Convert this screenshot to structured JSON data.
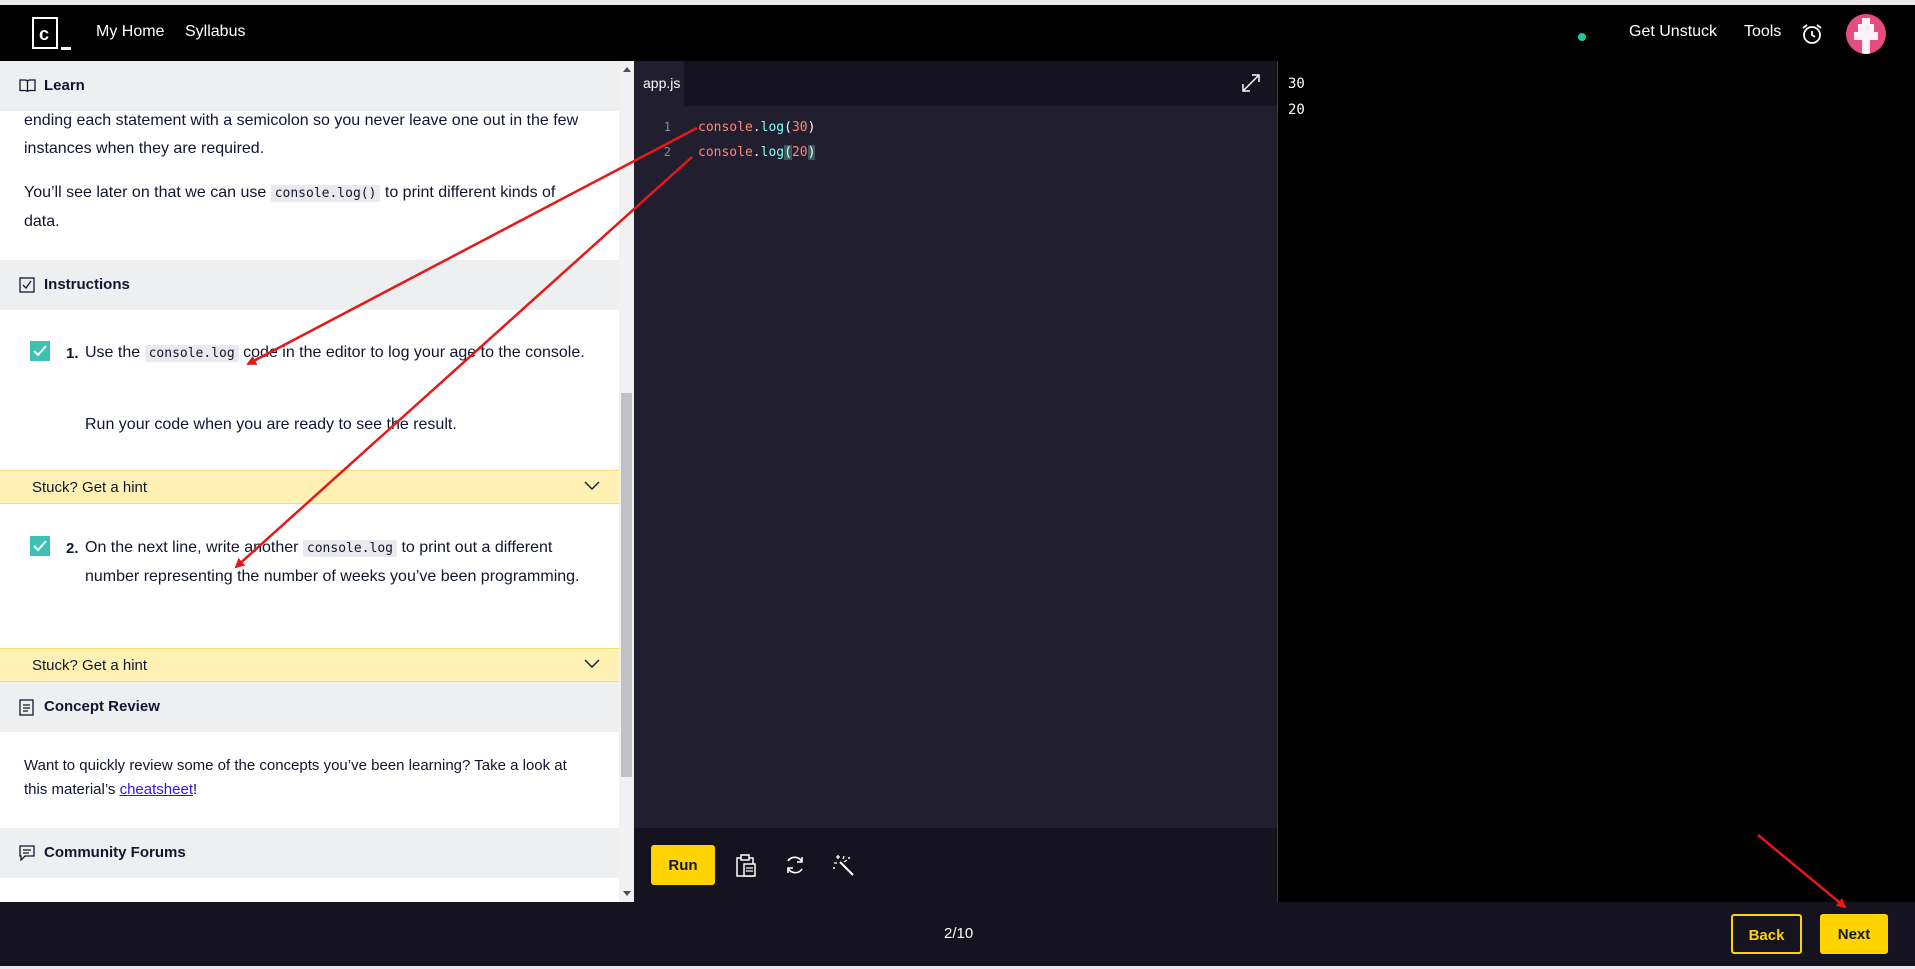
{
  "nav": {
    "logo_letter": "c",
    "my_home": "My Home",
    "syllabus": "Syllabus",
    "get_unstuck": "Get Unstuck",
    "tools": "Tools",
    "status_color": "#19c9a3",
    "avatar_color": "#e64c7d"
  },
  "learn": {
    "header": "Learn",
    "para1": "ending each statement with a semicolon so you never leave one out in the few instances when they are required.",
    "para2_before": "You’ll see later on that we can use ",
    "para2_code": "console.log()",
    "para2_after": " to print different kinds of data."
  },
  "instructions": {
    "header": "Instructions",
    "steps": [
      {
        "number": "1.",
        "text_before": "Use the ",
        "code": "console.log",
        "text_after": " code in the editor to log your age to the console.",
        "extra": "Run your code when you are ready to see the result.",
        "checked": true
      },
      {
        "number": "2.",
        "text_before": "On the next line, write another ",
        "code": "console.log",
        "text_after": " to print out a different number representing the number of weeks you’ve been programming.",
        "checked": true
      }
    ],
    "hint_label": "Stuck? Get a hint"
  },
  "concept_review": {
    "header": "Concept Review",
    "text_before": "Want to quickly review some of the concepts you’ve been learning? Take a look at this material’s ",
    "link": "cheatsheet",
    "text_after": "!"
  },
  "community": {
    "header": "Community Forums"
  },
  "editor": {
    "tab": "app.js",
    "lines": [
      {
        "num": "1",
        "obj": "console",
        "dot": ".",
        "fn": "log",
        "open": "(",
        "arg": "30",
        "close": ")"
      },
      {
        "num": "2",
        "obj": "console",
        "dot": ".",
        "fn": "log",
        "open": "(",
        "arg": "20",
        "close": ")"
      }
    ],
    "run_label": "Run"
  },
  "output": {
    "lines": [
      "30",
      "20"
    ]
  },
  "footer": {
    "progress": "2/10",
    "back_label": "Back",
    "next_label": "Next"
  },
  "colors": {
    "accent": "#ffd300",
    "hint_bg": "#fff0b3",
    "check": "#3ec1b3",
    "annotation_arrow": "#e61919"
  }
}
